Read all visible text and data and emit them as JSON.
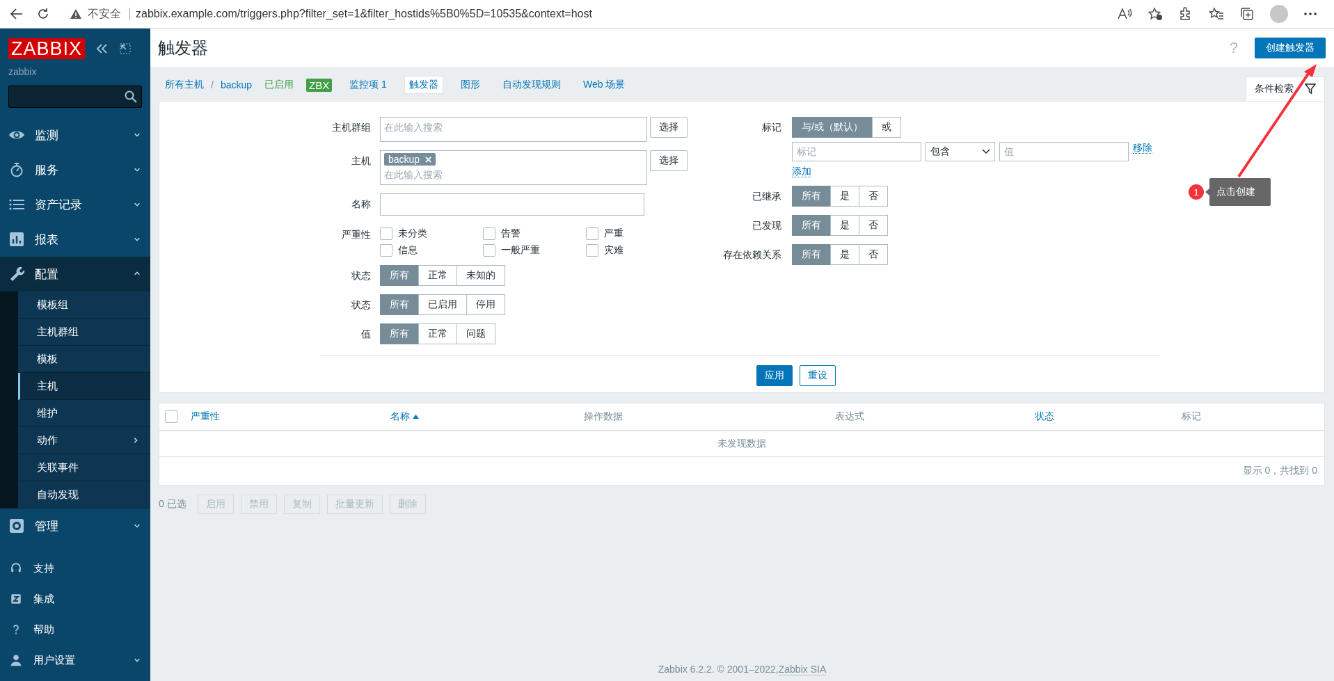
{
  "browser": {
    "security": "不安全",
    "url": "zabbix.example.com/triggers.php?filter_set=1&filter_hostids%5B0%5D=10535&context=host"
  },
  "sidebar": {
    "logo": "ZABBIX",
    "server": "zabbix",
    "menu": [
      {
        "label": "监测",
        "kind": "eye",
        "expanded": false
      },
      {
        "label": "服务",
        "kind": "stopwatch",
        "expanded": false
      },
      {
        "label": "资产记录",
        "kind": "list",
        "expanded": false
      },
      {
        "label": "报表",
        "kind": "chart",
        "expanded": false
      },
      {
        "label": "配置",
        "kind": "wrench",
        "expanded": true,
        "children": [
          {
            "label": "模板组",
            "selected": false,
            "submenu": false
          },
          {
            "label": "主机群组",
            "selected": false,
            "submenu": false
          },
          {
            "label": "模板",
            "selected": false,
            "submenu": false
          },
          {
            "label": "主机",
            "selected": true,
            "submenu": false
          },
          {
            "label": "维护",
            "selected": false,
            "submenu": false
          },
          {
            "label": "动作",
            "selected": false,
            "submenu": true
          },
          {
            "label": "关联事件",
            "selected": false,
            "submenu": false
          },
          {
            "label": "自动发现",
            "selected": false,
            "submenu": false
          }
        ]
      },
      {
        "label": "管理",
        "kind": "gear",
        "expanded": false
      }
    ],
    "secondary": [
      {
        "label": "支持",
        "kind": "headset",
        "expandable": false
      },
      {
        "label": "集成",
        "kind": "integration",
        "expandable": false
      },
      {
        "label": "帮助",
        "kind": "help",
        "expandable": false
      },
      {
        "label": "用户设置",
        "kind": "user",
        "expandable": true
      }
    ]
  },
  "header": {
    "title": "触发器",
    "help": "?",
    "create_button": "创建触发器"
  },
  "nav": {
    "breadcrumbs": [
      "所有主机",
      "backup"
    ],
    "separator": "/",
    "status": "已启用",
    "badge": "ZBX",
    "tabs": [
      {
        "label": "监控项",
        "count": "1",
        "selected": false
      },
      {
        "label": "触发器",
        "selected": true
      },
      {
        "label": "图形",
        "selected": false
      },
      {
        "label": "自动发现规则",
        "selected": false
      },
      {
        "label": "Web 场景",
        "selected": false
      }
    ],
    "filter_tab": "条件检索"
  },
  "filter": {
    "left": [
      {
        "kind": "multiselect",
        "label": "主机群组",
        "placeholder": "在此输入搜索",
        "button": "选择"
      },
      {
        "kind": "multiselect",
        "label": "主机",
        "chips": [
          "backup"
        ],
        "placeholder": "在此输入搜索",
        "button": "选择"
      },
      {
        "kind": "text",
        "label": "名称"
      },
      {
        "kind": "checkboxes",
        "label": "严重性",
        "options": [
          {
            "label": "未分类",
            "checked": false
          },
          {
            "label": "告警",
            "checked": false
          },
          {
            "label": "严重",
            "checked": false
          },
          {
            "label": "信息",
            "checked": false
          },
          {
            "label": "一般严重",
            "checked": false
          },
          {
            "label": "灾难",
            "checked": false
          }
        ]
      },
      {
        "kind": "segmented",
        "label": "状态",
        "options": [
          {
            "label": "所有",
            "selected": true
          },
          {
            "label": "正常",
            "selected": false
          },
          {
            "label": "未知的",
            "selected": false
          }
        ]
      },
      {
        "kind": "segmented",
        "label": "状态",
        "options": [
          {
            "label": "所有",
            "selected": true
          },
          {
            "label": "已启用",
            "selected": false
          },
          {
            "label": "停用",
            "selected": false
          }
        ]
      },
      {
        "kind": "segmented",
        "label": "值",
        "options": [
          {
            "label": "所有",
            "selected": true
          },
          {
            "label": "正常",
            "selected": false
          },
          {
            "label": "问题",
            "selected": false
          }
        ]
      }
    ],
    "right": [
      {
        "kind": "tags",
        "label": "标记",
        "options": [
          {
            "label": "与/或（默认）",
            "selected": true
          },
          {
            "label": "或",
            "selected": false
          }
        ],
        "tag_placeholder": "标记",
        "condition": "包含",
        "value_placeholder": "值",
        "remove": "移除",
        "add": "添加"
      },
      {
        "kind": "segmented",
        "label": "已继承",
        "options": [
          {
            "label": "所有",
            "selected": true
          },
          {
            "label": "是",
            "selected": false
          },
          {
            "label": "否",
            "selected": false
          }
        ]
      },
      {
        "kind": "segmented",
        "label": "已发现",
        "options": [
          {
            "label": "所有",
            "selected": true
          },
          {
            "label": "是",
            "selected": false
          },
          {
            "label": "否",
            "selected": false
          }
        ]
      },
      {
        "kind": "segmented",
        "label": "存在依赖关系",
        "options": [
          {
            "label": "所有",
            "selected": true
          },
          {
            "label": "是",
            "selected": false
          },
          {
            "label": "否",
            "selected": false
          }
        ]
      }
    ],
    "apply": "应用",
    "reset": "重设"
  },
  "table": {
    "select_all_checked": false,
    "columns": [
      {
        "label": "严重性",
        "sortable": true,
        "sorted": false
      },
      {
        "label": "名称",
        "sortable": true,
        "sorted": true
      },
      {
        "label": "操作数据",
        "sortable": false,
        "sorted": false
      },
      {
        "label": "表达式",
        "sortable": false,
        "sorted": false
      },
      {
        "label": "状态",
        "sortable": true,
        "sorted": false
      },
      {
        "label": "标记",
        "sortable": false,
        "sorted": false
      }
    ],
    "empty": "未发现数据",
    "paging": "显示 0，共找到 0"
  },
  "actions": {
    "selected": "0 已选",
    "buttons": [
      {
        "label": "启用",
        "disabled": true
      },
      {
        "label": "禁用",
        "disabled": true
      },
      {
        "label": "复制",
        "disabled": true
      },
      {
        "label": "批量更新",
        "disabled": true
      },
      {
        "label": "删除",
        "disabled": true
      }
    ]
  },
  "footer": {
    "text": "Zabbix 6.2.2. © 2001–2022, ",
    "link": "Zabbix SIA"
  },
  "annotation": {
    "badge": "1",
    "text": "点击创建"
  }
}
